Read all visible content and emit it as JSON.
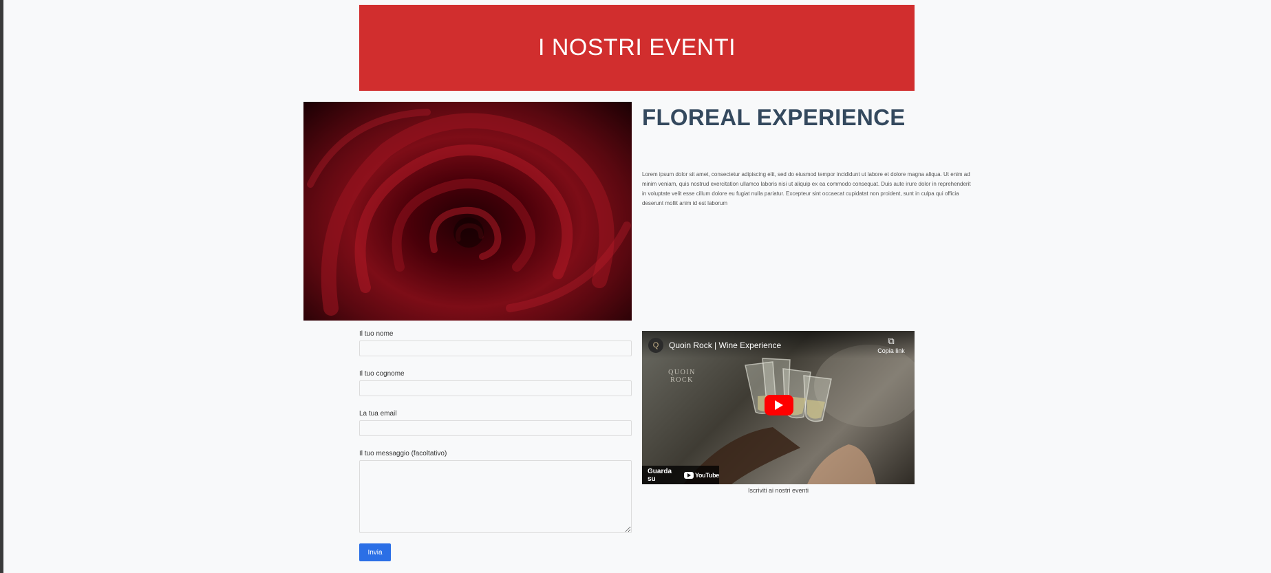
{
  "banner": {
    "title": "I NOSTRI EVENTI"
  },
  "event": {
    "title": "FLOREAL EXPERIENCE",
    "description": "Lorem ipsum dolor sit amet, consectetur adipiscing elit, sed do eiusmod tempor incididunt ut labore et dolore magna aliqua. Ut enim ad minim veniam, quis nostrud exercitation ullamco laboris nisi ut aliquip ex ea commodo consequat. Duis aute irure dolor in reprehenderit in voluptate velit esse cillum dolore eu fugiat nulla pariatur. Excepteur sint occaecat cupidatat non proident, sunt in culpa qui officia deserunt mollit anim id est laborum"
  },
  "form": {
    "first_name_label": "Il tuo nome",
    "first_name_value": "",
    "last_name_label": "Il tuo cognome",
    "last_name_value": "",
    "email_label": "La tua email",
    "email_value": "",
    "message_label": "Il tuo messaggio (facoltativo)",
    "message_value": "",
    "submit_label": "Invia"
  },
  "video": {
    "title": "Quoin Rock | Wine Experience",
    "copy_link_label": "Copia link",
    "watch_on_label": "Guarda su",
    "youtube_label": "YouTube",
    "brand_text": "QUOIN ROCK",
    "channel_initial": "Q"
  },
  "subscribe_caption": "Iscriviti ai nostri eventi",
  "colors": {
    "banner_bg": "#d12e2e",
    "title_color": "#34495e",
    "submit_bg": "#2b6fe6",
    "page_bg": "#f8f9fa"
  }
}
